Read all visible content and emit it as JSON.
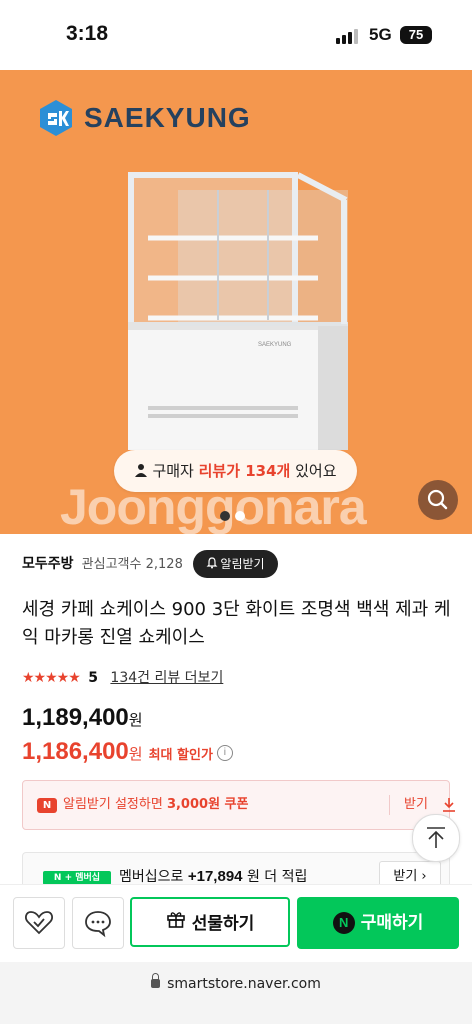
{
  "status_bar": {
    "time": "3:18",
    "network": "5G",
    "battery": "75"
  },
  "hero": {
    "brand_logo_text": "SAEKYUNG",
    "review_pill": {
      "prefix": "구매자 ",
      "highlight": "리뷰가 134개",
      "suffix": " 있어요"
    },
    "watermark": "Joonggonara",
    "carousel": {
      "total": 2,
      "active": 1
    }
  },
  "seller": {
    "name": "모두주방",
    "fans_label": "관심고객수",
    "fans_count": "2,128",
    "alert_button": "알림받기"
  },
  "product": {
    "title": "세경 카페 쇼케이스 900 3단 화이트 조명색 백색 제과 케익 마카롱 진열 쇼케이스",
    "stars": "★★★★★",
    "rating": "5",
    "review_link": "134건 리뷰 더보기",
    "price": "1,189,400",
    "price_unit": "원",
    "discount_price": "1,186,400",
    "discount_unit": "원",
    "discount_label": "최대 할인가"
  },
  "coupon": {
    "text_prefix": "알림받기 설정하면 ",
    "amount": "3,000원 쿠폰",
    "receive": "받기"
  },
  "membership": {
    "badge": "N + 멤버십",
    "prefix": "멤버십으로 ",
    "points": "+17,894",
    "suffix": "원 더 적립",
    "receive": "받기 ›"
  },
  "actions": {
    "gift": "선물하기",
    "buy": "구매하기",
    "n_logo": "N"
  },
  "browser": {
    "url": "smartstore.naver.com"
  },
  "colors": {
    "hero_bg": "#f4974e",
    "accent_red": "#e8432e",
    "naver_green": "#03c75a"
  },
  "icons": [
    "signal-icon",
    "person-icon",
    "search-icon",
    "bell-icon",
    "info-icon",
    "download-icon",
    "arrow-up-icon",
    "heart-icon",
    "chat-icon",
    "gift-icon",
    "lock-icon"
  ]
}
